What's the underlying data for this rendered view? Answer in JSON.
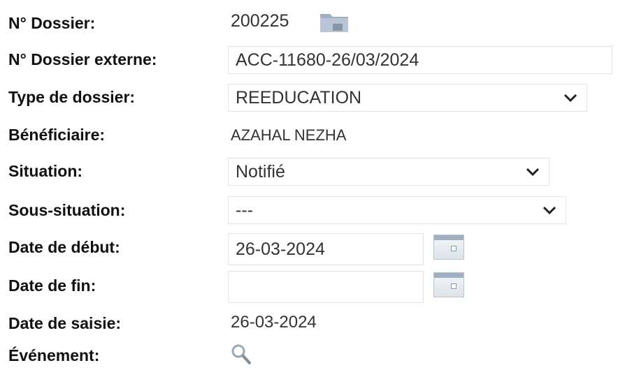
{
  "labels": {
    "dossier": "N° Dossier:",
    "dossier_externe": "N° Dossier externe:",
    "type_dossier": "Type de dossier:",
    "beneficiaire": "Bénéficiaire:",
    "situation": "Situation:",
    "sous_situation": "Sous-situation:",
    "date_debut": "Date de début:",
    "date_fin": "Date de fin:",
    "date_saisie": "Date de saisie:",
    "evenement": "Événement:"
  },
  "values": {
    "dossier": "200225",
    "dossier_externe": "ACC-11680-26/03/2024",
    "type_dossier": "REEDUCATION",
    "beneficiaire": "AZAHAL NEZHA",
    "situation": "Notifié",
    "sous_situation": "---",
    "date_debut": "26-03-2024",
    "date_fin": "",
    "date_saisie": "26-03-2024"
  },
  "icons": {
    "folder": "folder-icon",
    "calendar": "calendar-icon",
    "search": "search-icon",
    "chevron": "chevron-down-icon"
  }
}
